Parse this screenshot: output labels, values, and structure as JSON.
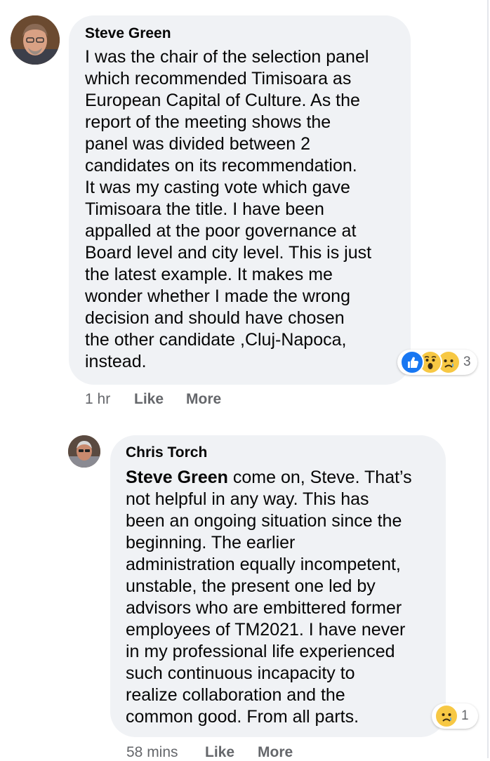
{
  "comments": [
    {
      "author": "Steve Green",
      "lines": [
        "I was the chair of the selection panel",
        "which recommended Timisoara as",
        "European Capital of Culture. As the",
        "report of the meeting shows the",
        "panel was divided between 2",
        "candidates on its recommendation.",
        "It was my casting vote which gave",
        "Timisoara the title. I have been",
        "appalled at the poor governance at",
        "Board level and city level. This is just",
        "the latest example. It makes me",
        "wonder whether I made the wrong",
        "decision and should have chosen",
        "the other candidate ,Cluj-Napoca,",
        "instead."
      ],
      "reactions": {
        "icons": [
          "like-icon",
          "wow-icon",
          "sad-icon"
        ],
        "count": "3"
      },
      "time": "1 hr",
      "like_label": "Like",
      "more_label": "More"
    },
    {
      "author": "Chris Torch",
      "mention": "Steve Green",
      "first_line_rest": " come on, Steve. That’s",
      "lines": [
        "not helpful in any way. This has",
        "been an ongoing situation since the",
        "beginning. The earlier",
        "administration equally incompetent,",
        "unstable, the present one led by",
        "advisors who are embittered former",
        "employees of TM2021. I have never",
        "in my professional life experienced",
        "such continuous incapacity to",
        "realize collaboration and the",
        "common good. From all parts."
      ],
      "reactions": {
        "icons": [
          "sad-icon"
        ],
        "count": "1"
      },
      "time": "58 mins",
      "like_label": "Like",
      "more_label": "More"
    }
  ],
  "colors": {
    "bubble": "#f0f2f5",
    "meta": "#65676b",
    "like_blue": "#1877f2",
    "emoji_yellow": "#f7c844"
  }
}
